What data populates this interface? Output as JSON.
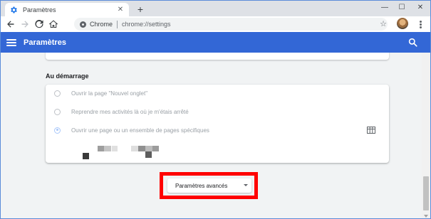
{
  "window": {
    "tab_title": "Paramètres",
    "tab_favicon": "gear-icon",
    "new_tab_symbol": "+",
    "controls": {
      "minimize": "—",
      "maximize": "☐",
      "close": "✕"
    }
  },
  "toolbar": {
    "site_chip": "Chrome",
    "url": "chrome://settings",
    "star_symbol": "☆"
  },
  "header": {
    "title": "Paramètres",
    "accent_color": "#3367d6"
  },
  "startup": {
    "section_title": "Au démarrage",
    "options": [
      {
        "label": "Ouvrir la page \"Nouvel onglet\"",
        "checked": false
      },
      {
        "label": "Reprendre mes activités là où je m'étais arrêté",
        "checked": false
      },
      {
        "label": "Ouvrir une page ou un ensemble de pages spécifiques",
        "checked": true
      }
    ]
  },
  "advanced": {
    "label": "Paramètres avancés",
    "highlight_color": "#ff0000"
  }
}
